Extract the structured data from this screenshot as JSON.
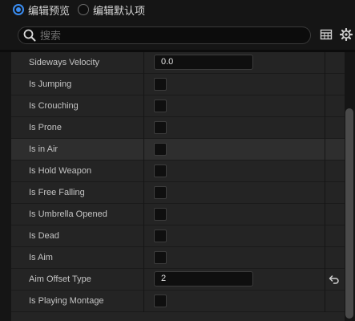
{
  "mode": {
    "preview_label": "编辑预览",
    "defaults_label": "编辑默认项",
    "selected": "preview"
  },
  "search": {
    "placeholder": "搜索"
  },
  "toolbar": {
    "icons": [
      "table-view-icon",
      "settings-gear-icon"
    ]
  },
  "properties": [
    {
      "label": "Sideways Velocity",
      "type": "number",
      "value": "0.0"
    },
    {
      "label": "Is Jumping",
      "type": "checkbox",
      "checked": false
    },
    {
      "label": "Is Crouching",
      "type": "checkbox",
      "checked": false
    },
    {
      "label": "Is Prone",
      "type": "checkbox",
      "checked": false
    },
    {
      "label": "Is in Air",
      "type": "checkbox",
      "checked": false,
      "highlighted": true
    },
    {
      "label": "Is Hold Weapon",
      "type": "checkbox",
      "checked": false
    },
    {
      "label": "Is Free Falling",
      "type": "checkbox",
      "checked": false
    },
    {
      "label": "Is Umbrella Opened",
      "type": "checkbox",
      "checked": false
    },
    {
      "label": "Is Dead",
      "type": "checkbox",
      "checked": false
    },
    {
      "label": "Is Aim",
      "type": "checkbox",
      "checked": false
    },
    {
      "label": "Aim Offset Type",
      "type": "number",
      "value": "2",
      "reset_to_default": true
    },
    {
      "label": "Is Playing Montage",
      "type": "checkbox",
      "checked": false
    }
  ],
  "colors": {
    "accent": "#3a8cf0",
    "panel": "#242424",
    "background": "#151515"
  }
}
